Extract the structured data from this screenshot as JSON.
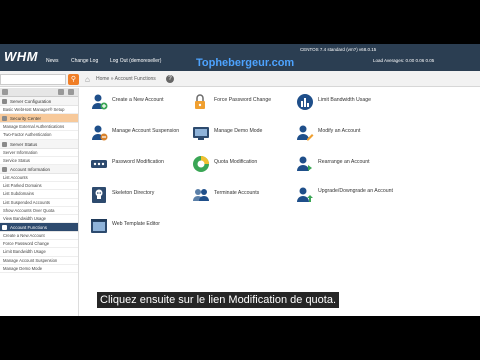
{
  "topbar": {
    "logo": "WHM",
    "nav": [
      "News",
      "Change Log",
      "Log Out (demoreseller)"
    ],
    "sysinfo": "CENTOS 7.4 standard (vm?)   v68.0.15",
    "loadinfo": "Load Averages: 0.00 0.06 0.05",
    "watermark": "Tophebergeur.com"
  },
  "toolbar": {
    "search_placeholder": "",
    "breadcrumb": "Home » Account Functions"
  },
  "sidebar": {
    "sections": [
      {
        "type": "header",
        "label": "Server Configuration",
        "active": false
      },
      {
        "type": "item",
        "label": "Basic WebHost Manager® Setup"
      },
      {
        "type": "header",
        "label": "Security Center",
        "active": false,
        "highlight": true
      },
      {
        "type": "item",
        "label": "Manage External Authentications"
      },
      {
        "type": "item",
        "label": "Two-Factor Authentication"
      },
      {
        "type": "header",
        "label": "Server Status",
        "active": false
      },
      {
        "type": "item",
        "label": "Server Information"
      },
      {
        "type": "item",
        "label": "Service Status"
      },
      {
        "type": "header",
        "label": "Account Information",
        "active": false
      },
      {
        "type": "item",
        "label": "List Accounts"
      },
      {
        "type": "item",
        "label": "List Parked Domains"
      },
      {
        "type": "item",
        "label": "List Subdomains"
      },
      {
        "type": "item",
        "label": "List Suspended Accounts"
      },
      {
        "type": "item",
        "label": "Show Accounts Over Quota"
      },
      {
        "type": "item",
        "label": "View Bandwidth Usage"
      },
      {
        "type": "header",
        "label": "Account Functions",
        "active": true
      },
      {
        "type": "item",
        "label": "Create a New Account"
      },
      {
        "type": "item",
        "label": "Force Password Change"
      },
      {
        "type": "item",
        "label": "Limit Bandwidth Usage"
      },
      {
        "type": "item",
        "label": "Manage Account Suspension"
      },
      {
        "type": "item",
        "label": "Manage Demo Mode"
      }
    ]
  },
  "functions": [
    {
      "label": "Create a New Account",
      "icon": "add-user-icon"
    },
    {
      "label": "Force Password Change",
      "icon": "password-lock-icon"
    },
    {
      "label": "Limit Bandwidth Usage",
      "icon": "bandwidth-icon"
    },
    {
      "label": "Manage Account Suspension",
      "icon": "user-suspend-icon"
    },
    {
      "label": "Manage Demo Mode",
      "icon": "demo-mode-icon"
    },
    {
      "label": "Modify an Account",
      "icon": "modify-user-icon"
    },
    {
      "label": "Password Modification",
      "icon": "password-field-icon"
    },
    {
      "label": "Quota Modification",
      "icon": "quota-pie-icon"
    },
    {
      "label": "Rearrange an Account",
      "icon": "rearrange-icon"
    },
    {
      "label": "Skeleton Directory",
      "icon": "skeleton-icon"
    },
    {
      "label": "Terminate Accounts",
      "icon": "terminate-users-icon"
    },
    {
      "label": "Upgrade/Downgrade an Account",
      "icon": "upgrade-icon"
    },
    {
      "label": "Web Template Editor",
      "icon": "template-editor-icon"
    }
  ],
  "subtitle": "Cliquez ensuite sur le lien Modification de quota."
}
